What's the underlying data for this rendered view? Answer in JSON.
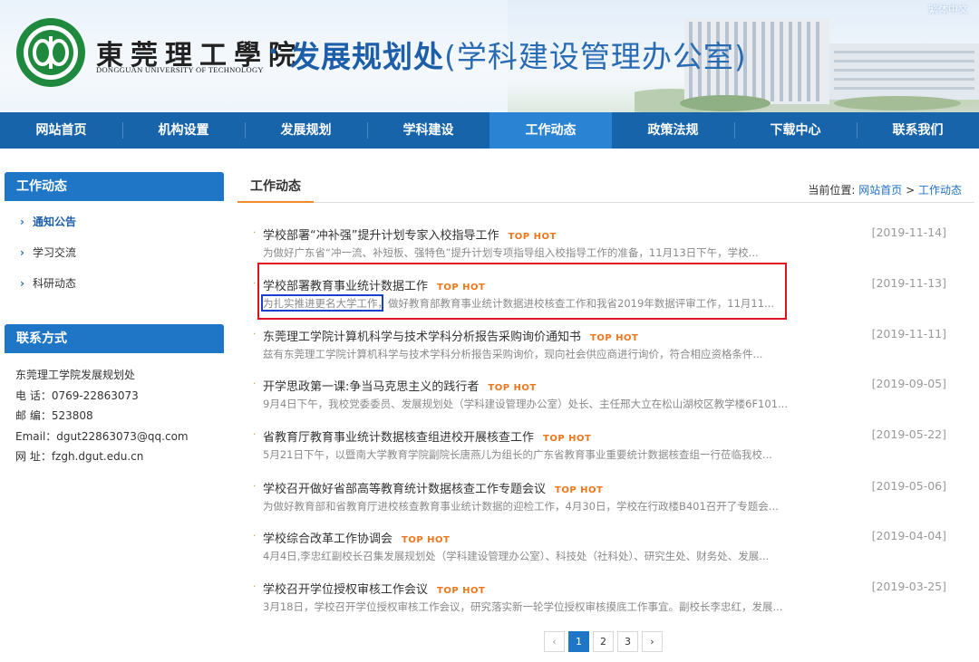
{
  "header": {
    "lang_switch": "繁体中文",
    "school_cn": "東莞理工學院",
    "school_en": "DONGGUAN UNIVERSITY OF TECHNOLOGY",
    "dept_main": "发展规划处",
    "dept_paren": "(学科建设管理办公室)"
  },
  "nav": [
    {
      "label": "网站首页"
    },
    {
      "label": "机构设置"
    },
    {
      "label": "发展规划"
    },
    {
      "label": "学科建设"
    },
    {
      "label": "工作动态"
    },
    {
      "label": "政策法规"
    },
    {
      "label": "下载中心"
    },
    {
      "label": "联系我们"
    }
  ],
  "nav_active": "工作动态",
  "sidebar": {
    "section_title": "工作动态",
    "items": [
      {
        "label": "通知公告"
      },
      {
        "label": "学习交流"
      },
      {
        "label": "科研动态"
      }
    ],
    "chevron": "›",
    "contact_title": "联系方式",
    "contact": {
      "org": "东莞理工学院发展规划处",
      "phone": "电  话：0769-22863073",
      "postcode": "邮  编：523808",
      "email": "Email：dgut22863073@qq.com",
      "site": "网  址：fzgh.dgut.edu.cn"
    }
  },
  "main": {
    "tab": "工作动态",
    "breadcrumb_prefix": "当前位置: ",
    "breadcrumb_home": "网站首页",
    "breadcrumb_sep": " > ",
    "breadcrumb_current": "工作动态",
    "hot_label": "TOP HOT",
    "bullet": "·",
    "news": [
      {
        "title": "学校部署“冲补强”提升计划专家入校指导工作",
        "desc": "为做好广东省“冲一流、补短板、强特色”提升计划专项指导组入校指导工作的准备，11月13日下午，学校...",
        "date": "[2019-11-14]"
      },
      {
        "title": "学校部署教育事业统计数据工作",
        "desc": "为扎实推进更名大学工作，做好教育部教育事业统计数据进校核查工作和我省2019年数据评审工作，11月11...",
        "date": "[2019-11-13]"
      },
      {
        "title": "东莞理工学院计算机科学与技术学科分析报告采购询价通知书",
        "desc": "兹有东莞理工学院计算机科学与技术学科分析报告采购询价，现向社会供应商进行询价，符合相应资格条件...",
        "date": "[2019-11-11]"
      },
      {
        "title": "开学思政第一课:争当马克思主义的践行者",
        "desc": "9月4日下午，我校党委委员、发展规划处（学科建设管理办公室）处长、主任邢大立在松山湖校区教学楼6F101...",
        "date": "[2019-09-05]"
      },
      {
        "title": "省教育厅教育事业统计数据核查组进校开展核查工作",
        "desc": "5月21日下午，以暨南大学教育学院副院长唐燕儿为组长的广东省教育事业重要统计数据核查组一行莅临我校...",
        "date": "[2019-05-22]"
      },
      {
        "title": "学校召开做好省部高等教育统计数据核查工作专题会议",
        "desc": "为做好教育部和省教育厅进校核查教育事业统计数据的迎检工作，4月30日，学校在行政楼B401召开了专题会...",
        "date": "[2019-05-06]"
      },
      {
        "title": "学校综合改革工作协调会",
        "desc": "4月4日,李忠红副校长召集发展规划处（学科建设管理办公室）、科技处（社科处）、研究生处、财务处、发展...",
        "date": "[2019-04-04]"
      },
      {
        "title": "学校召开学位授权审核工作会议",
        "desc": "3月18日，学校召开学位授权审核工作会议，研究落实新一轮学位授权审核摸底工作事宜。副校长李忠红，发展...",
        "date": "[2019-03-25]"
      }
    ]
  },
  "pager": {
    "prev": "‹",
    "pages": [
      "1",
      "2",
      "3"
    ],
    "current": "1",
    "next": "›"
  },
  "colors": {
    "nav_bg": "#1864ab",
    "nav_active": "#2b83d3",
    "accent_orange": "#f08c2c",
    "highlight_red": "#e0141e",
    "highlight_blue": "#1b3fcf"
  }
}
